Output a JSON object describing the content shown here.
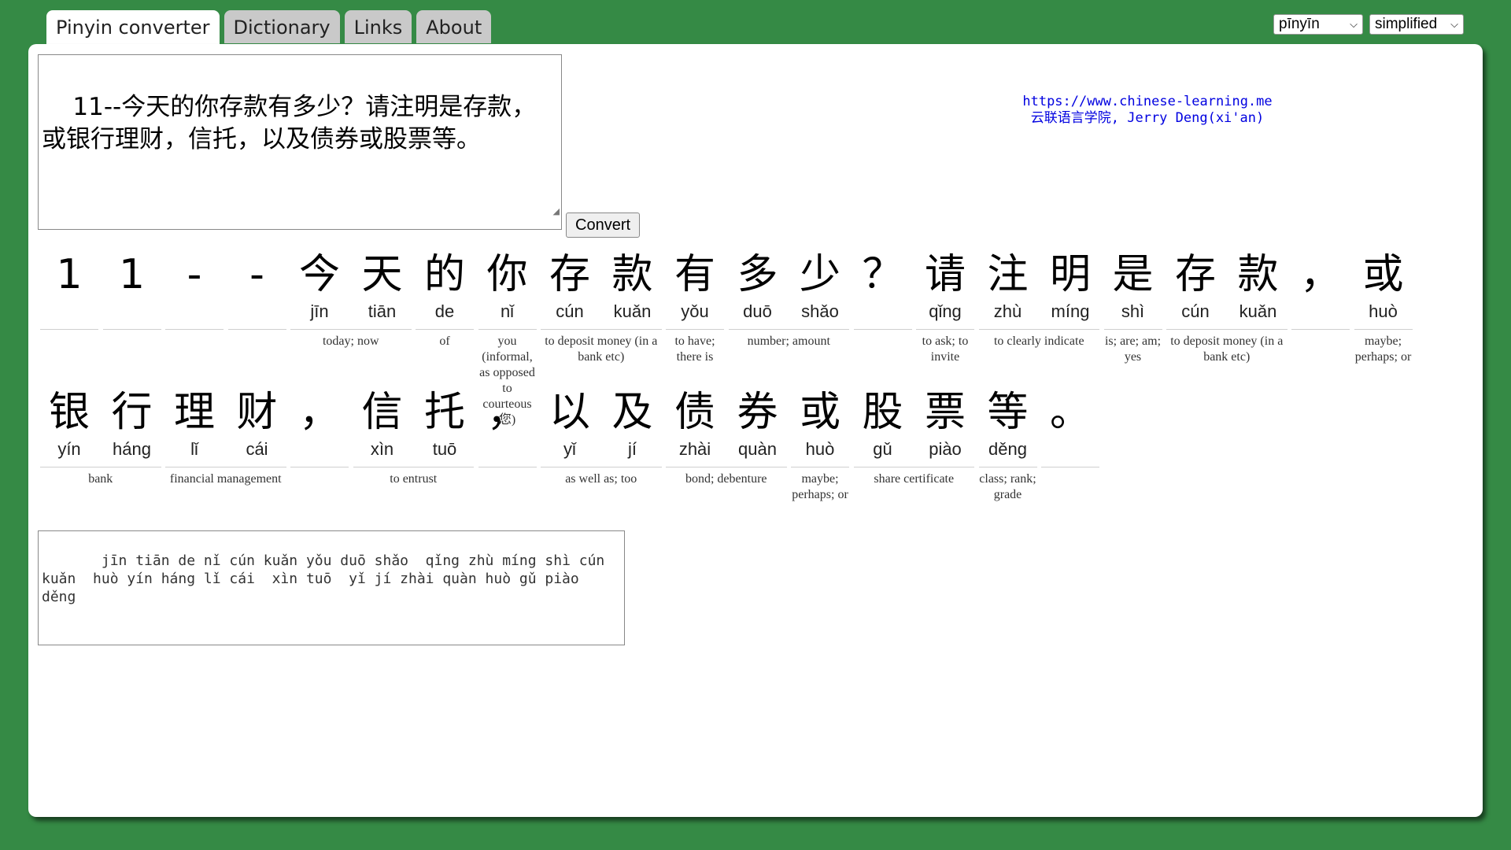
{
  "tabs": [
    {
      "label": "Pinyin converter",
      "active": true
    },
    {
      "label": "Dictionary",
      "active": false
    },
    {
      "label": "Links",
      "active": false
    },
    {
      "label": "About",
      "active": false
    }
  ],
  "selects": {
    "tone_mode": "pīnyīn",
    "script": "simplified"
  },
  "input": {
    "text": "11--今天的你存款有多少？请注明是存款，或银行理财，信托，以及债券或股票等。"
  },
  "convert_label": "Convert",
  "credit": {
    "url": "https://www.chinese-learning.me",
    "author": "云联语言学院, Jerry Deng(xi'an)"
  },
  "rows": [
    {
      "chars": [
        {
          "h": "1",
          "p": ""
        },
        {
          "h": "1",
          "p": ""
        },
        {
          "h": "-",
          "p": ""
        },
        {
          "h": "-",
          "p": ""
        },
        {
          "h": "今",
          "p": "jīn"
        },
        {
          "h": "天",
          "p": "tiān"
        },
        {
          "h": "的",
          "p": "de"
        },
        {
          "h": "你",
          "p": "nǐ"
        },
        {
          "h": "存",
          "p": "cún"
        },
        {
          "h": "款",
          "p": "kuǎn"
        },
        {
          "h": "有",
          "p": "yǒu"
        },
        {
          "h": "多",
          "p": "duō"
        },
        {
          "h": "少",
          "p": "shǎo"
        },
        {
          "h": "？",
          "p": ""
        },
        {
          "h": "请",
          "p": "qǐng"
        },
        {
          "h": "注",
          "p": "zhù"
        },
        {
          "h": "明",
          "p": "míng"
        },
        {
          "h": "是",
          "p": "shì"
        },
        {
          "h": "存",
          "p": "cún"
        },
        {
          "h": "款",
          "p": "kuǎn"
        },
        {
          "h": "，",
          "p": ""
        },
        {
          "h": "或",
          "p": "huò"
        }
      ],
      "words": [
        {
          "start": 0,
          "len": 1,
          "def": ""
        },
        {
          "start": 1,
          "len": 1,
          "def": ""
        },
        {
          "start": 2,
          "len": 1,
          "def": ""
        },
        {
          "start": 3,
          "len": 1,
          "def": ""
        },
        {
          "start": 4,
          "len": 2,
          "def": "today; now"
        },
        {
          "start": 6,
          "len": 1,
          "def": "of"
        },
        {
          "start": 7,
          "len": 1,
          "def": "you (informal, as opposed to courteous 您)"
        },
        {
          "start": 8,
          "len": 2,
          "def": "to deposit money (in a bank etc)"
        },
        {
          "start": 10,
          "len": 1,
          "def": "to have; there is"
        },
        {
          "start": 11,
          "len": 2,
          "def": "number; amount"
        },
        {
          "start": 13,
          "len": 1,
          "def": ""
        },
        {
          "start": 14,
          "len": 1,
          "def": "to ask; to invite"
        },
        {
          "start": 15,
          "len": 2,
          "def": "to clearly indicate"
        },
        {
          "start": 17,
          "len": 1,
          "def": "is; are; am; yes"
        },
        {
          "start": 18,
          "len": 2,
          "def": "to deposit money (in a bank etc)"
        },
        {
          "start": 20,
          "len": 1,
          "def": ""
        },
        {
          "start": 21,
          "len": 1,
          "def": "maybe; perhaps; or"
        }
      ]
    },
    {
      "chars": [
        {
          "h": "银",
          "p": "yín"
        },
        {
          "h": "行",
          "p": "háng"
        },
        {
          "h": "理",
          "p": "lǐ"
        },
        {
          "h": "财",
          "p": "cái"
        },
        {
          "h": "，",
          "p": ""
        },
        {
          "h": "信",
          "p": "xìn"
        },
        {
          "h": "托",
          "p": "tuō"
        },
        {
          "h": "，",
          "p": ""
        },
        {
          "h": "以",
          "p": "yǐ"
        },
        {
          "h": "及",
          "p": "jí"
        },
        {
          "h": "债",
          "p": "zhài"
        },
        {
          "h": "券",
          "p": "quàn"
        },
        {
          "h": "或",
          "p": "huò"
        },
        {
          "h": "股",
          "p": "gǔ"
        },
        {
          "h": "票",
          "p": "piào"
        },
        {
          "h": "等",
          "p": "děng"
        },
        {
          "h": "。",
          "p": ""
        }
      ],
      "words": [
        {
          "start": 0,
          "len": 2,
          "def": "bank"
        },
        {
          "start": 2,
          "len": 2,
          "def": "financial management"
        },
        {
          "start": 4,
          "len": 1,
          "def": ""
        },
        {
          "start": 5,
          "len": 2,
          "def": "to entrust"
        },
        {
          "start": 7,
          "len": 1,
          "def": ""
        },
        {
          "start": 8,
          "len": 2,
          "def": "as well as; too"
        },
        {
          "start": 10,
          "len": 2,
          "def": "bond; debenture"
        },
        {
          "start": 12,
          "len": 1,
          "def": "maybe; perhaps; or"
        },
        {
          "start": 13,
          "len": 2,
          "def": "share certificate"
        },
        {
          "start": 15,
          "len": 1,
          "def": "class; rank; grade"
        },
        {
          "start": 16,
          "len": 1,
          "def": ""
        }
      ]
    }
  ],
  "output": {
    "text": "   jīn tiān de nǐ cún kuǎn yǒu duō shǎo  qǐng zhù míng shì cún kuǎn  huò yín háng lǐ cái  xìn tuō  yǐ jí zhài quàn huò gǔ piào děng"
  }
}
